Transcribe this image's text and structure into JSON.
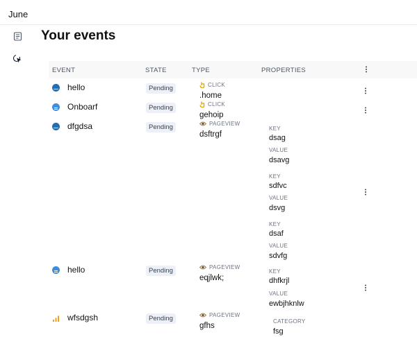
{
  "app": {
    "name": "June"
  },
  "page": {
    "title": "Your events"
  },
  "table": {
    "headers": {
      "event": "EVENT",
      "state": "STATE",
      "type": "TYPE",
      "properties": "PROPERTIES"
    },
    "rows": [
      {
        "name": "hello",
        "state": "Pending",
        "type": "CLICK",
        "value": ".home",
        "icon": "globe-icon"
      },
      {
        "name": "Onboarf",
        "state": "Pending",
        "type": "CLICK",
        "value": "gehoip",
        "icon": "segment-icon"
      },
      {
        "name": "dfgdsa",
        "state": "Pending",
        "type": "PAGEVIEW",
        "value": "dsftrgf",
        "icon": "globe-icon",
        "properties": [
          {
            "key_label": "KEY",
            "key": "dsag",
            "value_label": "VALUE",
            "value": "dsavg"
          },
          {
            "key_label": "KEY",
            "key": "sdfvc",
            "value_label": "VALUE",
            "value": "dsvg"
          },
          {
            "key_label": "KEY",
            "key": "dsaf",
            "value_label": "VALUE",
            "value": "sdvfg"
          },
          {
            "key_label": "KEY",
            "key": "dhfkrjl",
            "value_label": "VALUE",
            "value": "ewbjhknlw"
          }
        ]
      },
      {
        "name": "hello",
        "state": "Pending",
        "type": "PAGEVIEW",
        "value": "eqjlwk;",
        "icon": "segment-icon"
      },
      {
        "name": "wfsdgsh",
        "state": "Pending",
        "type": "PAGEVIEW",
        "value": "gfhs",
        "icon": "bar-chart-icon",
        "properties": [
          {
            "key_label": "CATEGORY",
            "key": "fsg"
          }
        ]
      }
    ]
  },
  "colors": {
    "globe": "#1d6fb8",
    "segment": "#3b8ee0",
    "amplitude": "#f59e0b",
    "click": "#eab308"
  }
}
